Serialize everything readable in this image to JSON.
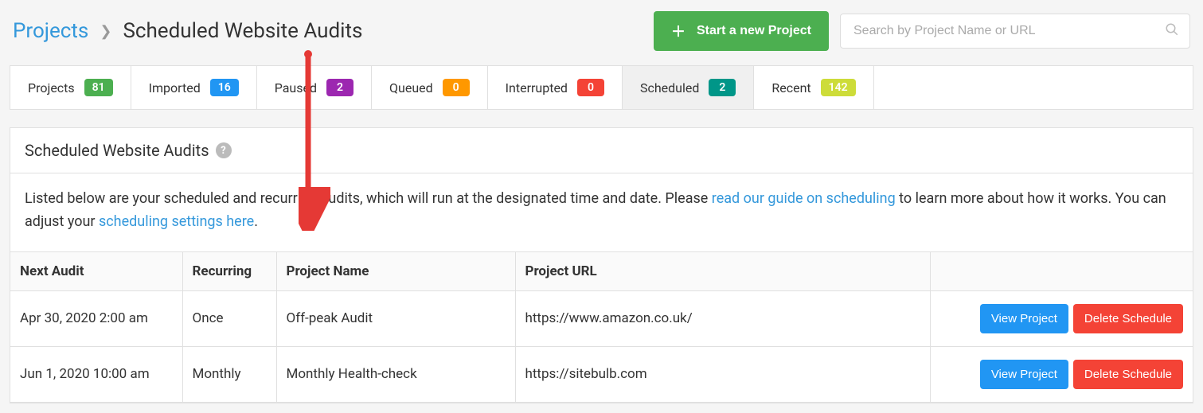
{
  "breadcrumb": {
    "root": "Projects",
    "current": "Scheduled Website Audits"
  },
  "actions": {
    "new_project": "Start a new Project",
    "search_placeholder": "Search by Project Name or URL"
  },
  "tabs": [
    {
      "label": "Projects",
      "count": "81",
      "color": "b-green"
    },
    {
      "label": "Imported",
      "count": "16",
      "color": "b-blue"
    },
    {
      "label": "Paused",
      "count": "2",
      "color": "b-purple"
    },
    {
      "label": "Queued",
      "count": "0",
      "color": "b-orange"
    },
    {
      "label": "Interrupted",
      "count": "0",
      "color": "b-red"
    },
    {
      "label": "Scheduled",
      "count": "2",
      "color": "b-teal"
    },
    {
      "label": "Recent",
      "count": "142",
      "color": "b-lime"
    }
  ],
  "active_tab_index": 5,
  "panel": {
    "title": "Scheduled Website Audits",
    "desc_1": "Listed below are your scheduled and recurring audits, which will run at the designated time and date. Please ",
    "link_1": "read our guide on scheduling",
    "desc_2": " to learn more about how it works. You can adjust your ",
    "link_2": "scheduling settings here",
    "desc_3": "."
  },
  "table": {
    "headers": {
      "next_audit": "Next Audit",
      "recurring": "Recurring",
      "project_name": "Project Name",
      "project_url": "Project URL"
    },
    "rows": [
      {
        "next_audit": "Apr 30, 2020 2:00 am",
        "recurring": "Once",
        "project_name": "Off-peak Audit",
        "project_url": "https://www.amazon.co.uk/"
      },
      {
        "next_audit": "Jun 1, 2020 10:00 am",
        "recurring": "Monthly",
        "project_name": "Monthly Health-check",
        "project_url": "https://sitebulb.com"
      }
    ],
    "buttons": {
      "view": "View Project",
      "delete": "Delete Schedule"
    }
  }
}
